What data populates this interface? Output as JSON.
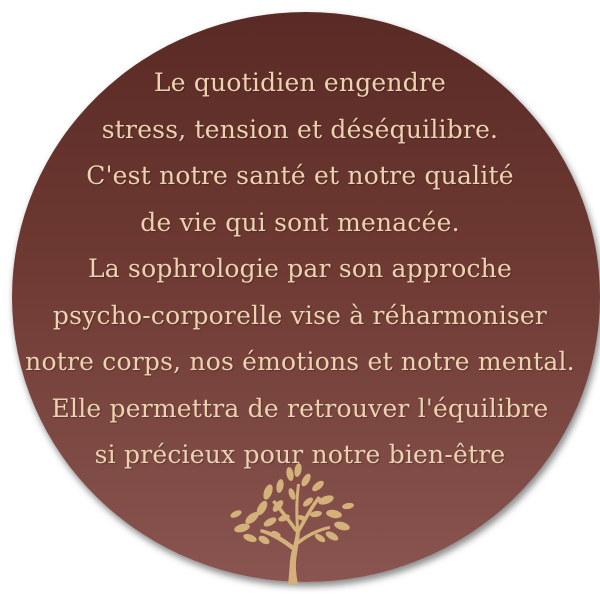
{
  "lines": [
    "Le quotidien engendre",
    "stress, tension et déséquilibre.",
    " C'est notre santé et notre qualité",
    "de vie qui sont menacée.",
    "La sophrologie par son approche",
    " psycho-corporelle vise à  réharmoniser",
    "notre corps, nos émotions et notre mental.",
    "Elle permettra de retrouver l'équilibre",
    "si précieux pour notre bien-être"
  ],
  "colors": {
    "background": "#ffffff",
    "disc_top": "#5a2a25",
    "disc_bottom": "#8a5550",
    "text": "#ecd2b0",
    "tree": "#d4b07a"
  },
  "icon": "tree-icon"
}
